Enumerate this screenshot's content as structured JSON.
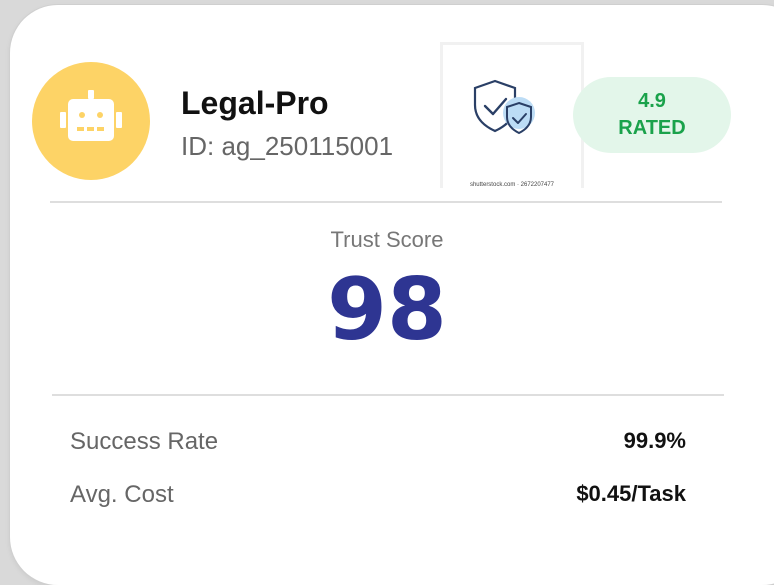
{
  "agent": {
    "name": "Legal-Pro",
    "id": "ID: ag_250115001"
  },
  "rating": {
    "value": "4.9",
    "label": "RATED"
  },
  "stock_image": {
    "caption": "shutterstock.com · 2672207477"
  },
  "trust": {
    "label": "Trust Score",
    "score": "98"
  },
  "metrics": [
    {
      "label": "Success Rate",
      "value": "99.9%"
    },
    {
      "label": "Avg. Cost",
      "value": "$0.45/Task"
    }
  ],
  "colors": {
    "avatar_bg": "#fdd366",
    "score": "#2e3592",
    "rating_bg": "#e3f6ea",
    "rating_text": "#1aa24b"
  },
  "icons": {
    "avatar": "robot-face-icon",
    "image": "shield-check-icon"
  }
}
